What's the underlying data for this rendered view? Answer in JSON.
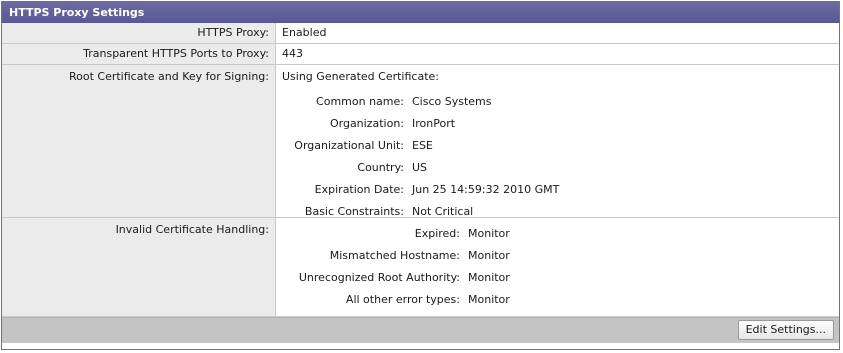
{
  "panel": {
    "title": "HTTPS Proxy Settings"
  },
  "rows": {
    "https_proxy": {
      "label": "HTTPS Proxy:",
      "value": "Enabled"
    },
    "ports": {
      "label": "Transparent HTTPS Ports to Proxy:",
      "value": "443"
    },
    "root_cert": {
      "label": "Root Certificate and Key for Signing:",
      "value": "Using Generated Certificate:",
      "fields": [
        {
          "key": "Common name:",
          "value": "Cisco Systems"
        },
        {
          "key": "Organization:",
          "value": "IronPort"
        },
        {
          "key": "Organizational Unit:",
          "value": "ESE"
        },
        {
          "key": "Country:",
          "value": "US"
        },
        {
          "key": "Expiration Date:",
          "value": "Jun 25 14:59:32 2010 GMT"
        },
        {
          "key": "Basic Constraints:",
          "value": "Not Critical"
        }
      ]
    },
    "invalid_cert": {
      "label": "Invalid Certificate Handling:",
      "fields": [
        {
          "key": "Expired:",
          "value": "Monitor"
        },
        {
          "key": "Mismatched Hostname:",
          "value": "Monitor"
        },
        {
          "key": "Unrecognized Root Authority:",
          "value": "Monitor"
        },
        {
          "key": "All other error types:",
          "value": "Monitor"
        }
      ]
    }
  },
  "footer": {
    "edit_label": "Edit Settings..."
  }
}
